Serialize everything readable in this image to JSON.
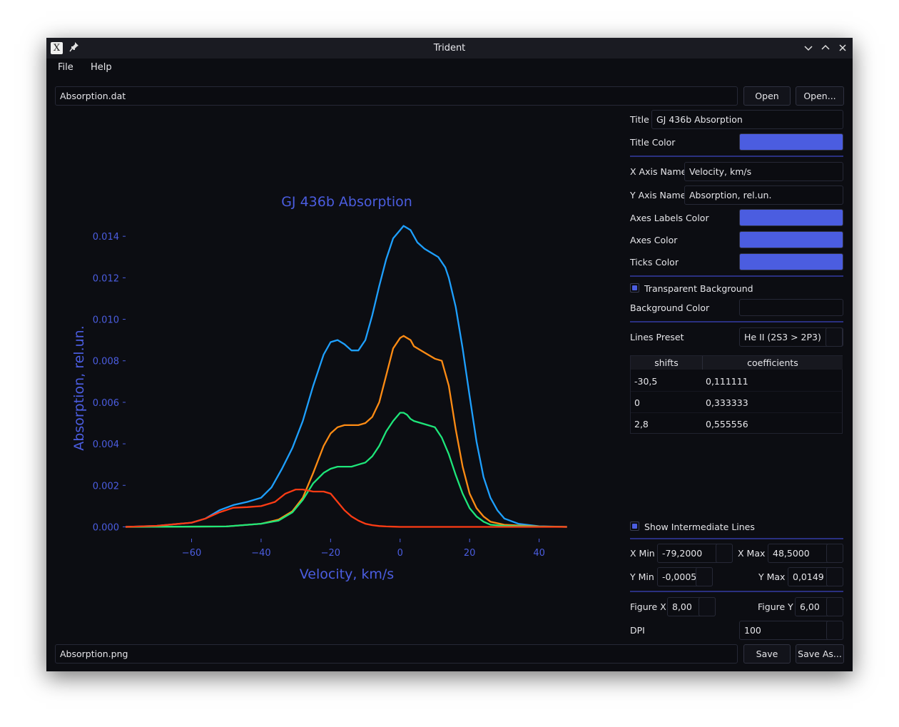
{
  "window": {
    "title": "Trident"
  },
  "menu": [
    "File",
    "Help"
  ],
  "input_file": {
    "value": "Absorption.dat",
    "open_label": "Open",
    "open_as_label": "Open..."
  },
  "output_file": {
    "value": "Absorption.png",
    "save_label": "Save",
    "save_as_label": "Save As..."
  },
  "settings": {
    "title_label": "Title",
    "title_value": "GJ 436b Absorption",
    "title_color_label": "Title Color",
    "x_axis_label": "X Axis Name",
    "x_axis_value": "Velocity, km/s",
    "y_axis_label": "Y Axis Name",
    "y_axis_value": "Absorption, rel.un.",
    "axes_labels_color_label": "Axes Labels Color",
    "axes_color_label": "Axes Color",
    "ticks_color_label": "Ticks Color",
    "transparent_bg_label": "Transparent Background",
    "transparent_bg_checked": true,
    "bg_color_label": "Background Color",
    "lines_preset_label": "Lines Preset",
    "lines_preset_value": "He II (2S3 > 2P3)",
    "show_intermediate_label": "Show Intermediate Lines",
    "show_intermediate_checked": true,
    "x_min_label": "X Min",
    "x_min": "-79,2000",
    "x_max_label": "X Max",
    "x_max": "48,5000",
    "y_min_label": "Y Min",
    "y_min": "-0,0005",
    "y_max_label": "Y Max",
    "y_max": "0,0149",
    "fig_x_label": "Figure X",
    "fig_x": "8,00",
    "fig_y_label": "Figure Y",
    "fig_y": "6,00",
    "dpi_label": "DPI",
    "dpi": "100",
    "accent_color": "#4b5de0"
  },
  "table": {
    "headers": [
      "shifts",
      "coefficients"
    ],
    "rows": [
      [
        "-30,5",
        "0,111111"
      ],
      [
        "0",
        "0,333333"
      ],
      [
        "2,8",
        "0,555556"
      ]
    ]
  },
  "chart_data": {
    "type": "line",
    "title": "GJ 436b Absorption",
    "xlabel": "Velocity, km/s",
    "ylabel": "Absorption, rel.un.",
    "xlim": [
      -79.2,
      48.5
    ],
    "ylim": [
      -0.0005,
      0.0149
    ],
    "x_ticks": [
      "−60",
      "−40",
      "−20",
      "0",
      "20",
      "40"
    ],
    "x_tick_values": [
      -60,
      -40,
      -20,
      0,
      20,
      40
    ],
    "y_ticks": [
      "0.000",
      "0.002",
      "0.004",
      "0.006",
      "0.008",
      "0.010",
      "0.012",
      "0.014"
    ],
    "y_tick_values": [
      0,
      0.002,
      0.004,
      0.006,
      0.008,
      0.01,
      0.012,
      0.014
    ],
    "label_color": "#4b5de0",
    "background": "#0c0d12",
    "series": [
      {
        "color": "#1ea0ff",
        "x": [
          -79,
          -70,
          -60,
          -56,
          -52,
          -48,
          -44,
          -40,
          -37,
          -34,
          -31,
          -28,
          -25,
          -22,
          -20,
          -18,
          -16,
          -14,
          -12,
          -10,
          -8,
          -6,
          -4,
          -2,
          0,
          1,
          2,
          3,
          4,
          5,
          7,
          9,
          11,
          13,
          14,
          16,
          18,
          20,
          22,
          24,
          26,
          28,
          30,
          34,
          40,
          48
        ],
        "y": [
          0,
          5e-05,
          0.0002,
          0.0004,
          0.0008,
          0.00105,
          0.0012,
          0.0014,
          0.0019,
          0.0028,
          0.0038,
          0.0051,
          0.0068,
          0.0083,
          0.0089,
          0.009,
          0.0088,
          0.0085,
          0.0085,
          0.009,
          0.0102,
          0.0116,
          0.0129,
          0.0139,
          0.0143,
          0.0145,
          0.0144,
          0.0143,
          0.014,
          0.0137,
          0.0134,
          0.0132,
          0.013,
          0.0125,
          0.012,
          0.0106,
          0.0086,
          0.0063,
          0.0041,
          0.0024,
          0.0014,
          0.0008,
          0.0004,
          0.00015,
          3e-05,
          0
        ]
      },
      {
        "color": "#ff8c14",
        "x": [
          -79,
          -50,
          -40,
          -35,
          -31,
          -28,
          -25,
          -22,
          -20,
          -18,
          -16,
          -14,
          -12,
          -10,
          -8,
          -6,
          -4,
          -2,
          0,
          1,
          2,
          3,
          4,
          6,
          8,
          10,
          12,
          14,
          16,
          18,
          20,
          22,
          24,
          26,
          30,
          40,
          48
        ],
        "y": [
          0,
          2e-05,
          0.00015,
          0.00035,
          0.00075,
          0.0014,
          0.0026,
          0.0039,
          0.0045,
          0.0048,
          0.0049,
          0.0049,
          0.0049,
          0.005,
          0.0053,
          0.006,
          0.0073,
          0.0086,
          0.0091,
          0.0092,
          0.0091,
          0.009,
          0.0087,
          0.0085,
          0.0083,
          0.0081,
          0.008,
          0.0068,
          0.0047,
          0.0029,
          0.0016,
          0.0009,
          0.0005,
          0.00025,
          0.0001,
          2e-05,
          0
        ]
      },
      {
        "color": "#1ee67a",
        "x": [
          -79,
          -50,
          -40,
          -35,
          -31,
          -28,
          -25,
          -22,
          -20,
          -18,
          -16,
          -14,
          -12,
          -10,
          -8,
          -6,
          -4,
          -2,
          0,
          1,
          2,
          3,
          4,
          6,
          8,
          10,
          12,
          14,
          16,
          18,
          20,
          22,
          24,
          26,
          30,
          40,
          48
        ],
        "y": [
          0,
          2e-05,
          0.00015,
          0.0003,
          0.0007,
          0.0013,
          0.0021,
          0.0026,
          0.0028,
          0.0029,
          0.0029,
          0.0029,
          0.003,
          0.0031,
          0.0034,
          0.0039,
          0.0046,
          0.0051,
          0.0055,
          0.0055,
          0.0054,
          0.0052,
          0.0051,
          0.005,
          0.0049,
          0.0048,
          0.0043,
          0.0035,
          0.0025,
          0.0016,
          0.0009,
          0.0005,
          0.00025,
          0.0001,
          5e-05,
          1e-05,
          0
        ]
      },
      {
        "color": "#ff3c14",
        "x": [
          -79,
          -70,
          -60,
          -56,
          -52,
          -48,
          -44,
          -40,
          -36,
          -33,
          -30,
          -28,
          -25,
          -22,
          -20,
          -18,
          -16,
          -14,
          -12,
          -10,
          -8,
          -6,
          -4,
          -2,
          0,
          5,
          10,
          20,
          48
        ],
        "y": [
          0,
          5e-05,
          0.0002,
          0.0004,
          0.0007,
          0.00092,
          0.00095,
          0.001,
          0.0012,
          0.0016,
          0.0018,
          0.0018,
          0.0017,
          0.0017,
          0.0016,
          0.0012,
          0.0008,
          0.0005,
          0.0003,
          0.00015,
          8e-05,
          4e-05,
          2e-05,
          1e-05,
          0,
          0,
          0,
          0,
          0
        ]
      }
    ]
  }
}
